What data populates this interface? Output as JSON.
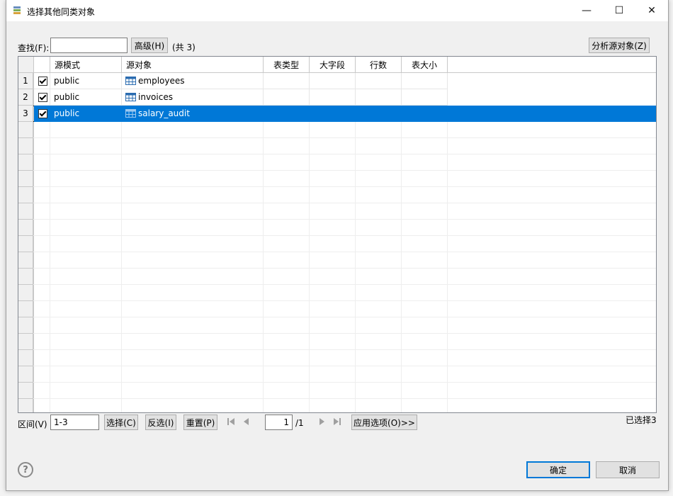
{
  "dialog": {
    "title": "选择其他同类对象",
    "minimize_glyph": "—",
    "maximize_glyph": "☐",
    "close_glyph": "✕"
  },
  "search": {
    "label": "查找(F):",
    "value": "",
    "advanced_button": "高级(H)",
    "total_text": "(共 3)",
    "analyze_button": "分析源对象(Z)"
  },
  "table": {
    "columns": [
      "源模式",
      "源对象",
      "表类型",
      "大字段",
      "行数",
      "表大小"
    ],
    "rows": [
      {
        "num": "1",
        "checked": true,
        "schema": "public",
        "object": "employees",
        "selected": false
      },
      {
        "num": "2",
        "checked": true,
        "schema": "public",
        "object": "invoices",
        "selected": false
      },
      {
        "num": "3",
        "checked": true,
        "schema": "public",
        "object": "salary_audit",
        "selected": true
      }
    ]
  },
  "footer": {
    "range_label": "区间(V)",
    "range_value": "1-3",
    "select_button": "选择(C)",
    "invert_button": "反选(I)",
    "reset_button": "重置(P)",
    "page_value": "1",
    "page_total": "/1",
    "apply_button": "应用选项(O)>>",
    "selected_count": "已选择3"
  },
  "actions": {
    "ok_button": "确定",
    "cancel_button": "取消",
    "help_glyph": "?"
  },
  "colors": {
    "selection": "#0078d7",
    "ok_border": "#0078d7"
  }
}
